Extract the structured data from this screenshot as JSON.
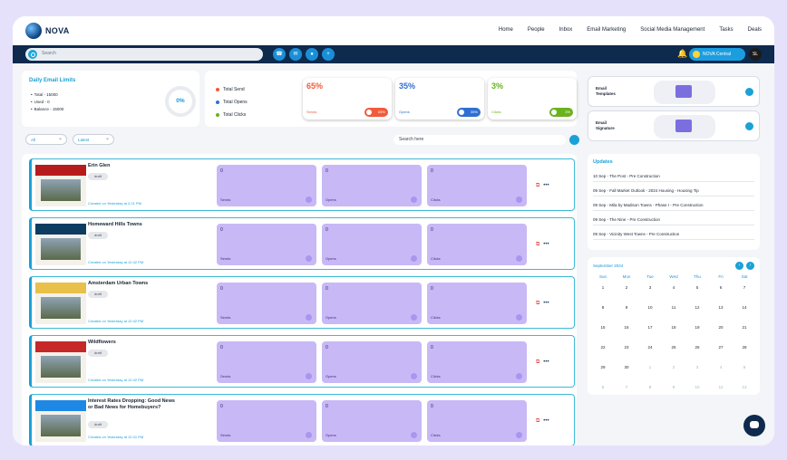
{
  "app": {
    "logo": "NOVA"
  },
  "nav": [
    "Home",
    "People",
    "Inbox",
    "Email Marketing",
    "Social Media Management",
    "Tasks",
    "Deals"
  ],
  "toolbar": {
    "search_placeholder": "Search",
    "nova_central": "NOVA Central",
    "avatar": "SL"
  },
  "limits": {
    "title": "Daily Email Limits",
    "items": [
      "Total - 15000",
      "Used - 0",
      "Balance - 15000"
    ],
    "usage": "0%"
  },
  "totals": {
    "legend": [
      {
        "label": "Total Send",
        "color": "#f15a3b"
      },
      {
        "label": "Total Opens",
        "color": "#2f6fd1"
      },
      {
        "label": "Total Clicks",
        "color": "#6ab21f"
      }
    ],
    "stats": [
      {
        "pct": "65%",
        "label": "Sends",
        "pill": "65%",
        "color": "#f15a3b"
      },
      {
        "pct": "35%",
        "label": "Opens",
        "pill": "35%",
        "color": "#2f6fd1"
      },
      {
        "pct": "3%",
        "label": "Clicks",
        "pill": "3%",
        "color": "#6ab21f"
      }
    ]
  },
  "filters": {
    "status": "All",
    "sort": "Latest",
    "search_placeholder": "Search here"
  },
  "campaigns": [
    {
      "title": "Erin Glen",
      "status": "draft",
      "created": "Created on Yesterday at 2:21 PM",
      "sends": "0",
      "opens": "0",
      "clicks": "0",
      "band": "#b71c1c"
    },
    {
      "title": "Homeward Hills Towns",
      "status": "draft",
      "created": "Created on Yesterday at 12:42 PM",
      "sends": "0",
      "opens": "0",
      "clicks": "0",
      "band": "#0d3c61"
    },
    {
      "title": "Amsterdam Urban Towns",
      "status": "draft",
      "created": "Created on Yesterday at 12:42 PM",
      "sends": "0",
      "opens": "0",
      "clicks": "0",
      "band": "#e8c04a"
    },
    {
      "title": "Wildflowers",
      "status": "draft",
      "created": "Created on Yesterday at 12:42 PM",
      "sends": "0",
      "opens": "0",
      "clicks": "0",
      "band": "#c62828"
    },
    {
      "title": "Interest Rates Dropping: Good News or Bad News for Homebuyers?",
      "status": "draft",
      "created": "Created on Yesterday at 12:41 PM",
      "sends": "0",
      "opens": "0",
      "clicks": "0",
      "band": "#1e88e5"
    }
  ],
  "metric_labels": {
    "sends": "Sends",
    "opens": "Opens",
    "clicks": "Clicks"
  },
  "templates": [
    {
      "title_line1": "Email",
      "title_line2": "Templates"
    },
    {
      "title_line1": "Email",
      "title_line2": "Signature"
    }
  ],
  "updates": {
    "title": "Updates",
    "items": [
      "10 Sep - The Post - Pre Construction",
      "09 Sep - Fall Market Outlook - 2024 Housing - Housing Tip",
      "09 Sep - Mila by Madison Towns - Phase I - Pre Construction",
      "09 Sep - The Nine - Pre Construction",
      "09 Sep - Vicinity West Towns - Pre Construction"
    ]
  },
  "calendar": {
    "title": "September 2024",
    "days": [
      "Sun",
      "Mon",
      "Tue",
      "Wed",
      "Thu",
      "Fri",
      "Sat"
    ],
    "cells": [
      "1",
      "2",
      "3",
      "4",
      "5",
      "6",
      "7",
      "8",
      "9",
      "10",
      "11",
      "12",
      "13",
      "14",
      "15",
      "16",
      "17",
      "18",
      "19",
      "20",
      "21",
      "22",
      "23",
      "24",
      "25",
      "26",
      "27",
      "28",
      "29",
      "30",
      "1",
      "2",
      "3",
      "4",
      "5",
      "6",
      "7",
      "8",
      "9",
      "10",
      "11",
      "12"
    ]
  }
}
